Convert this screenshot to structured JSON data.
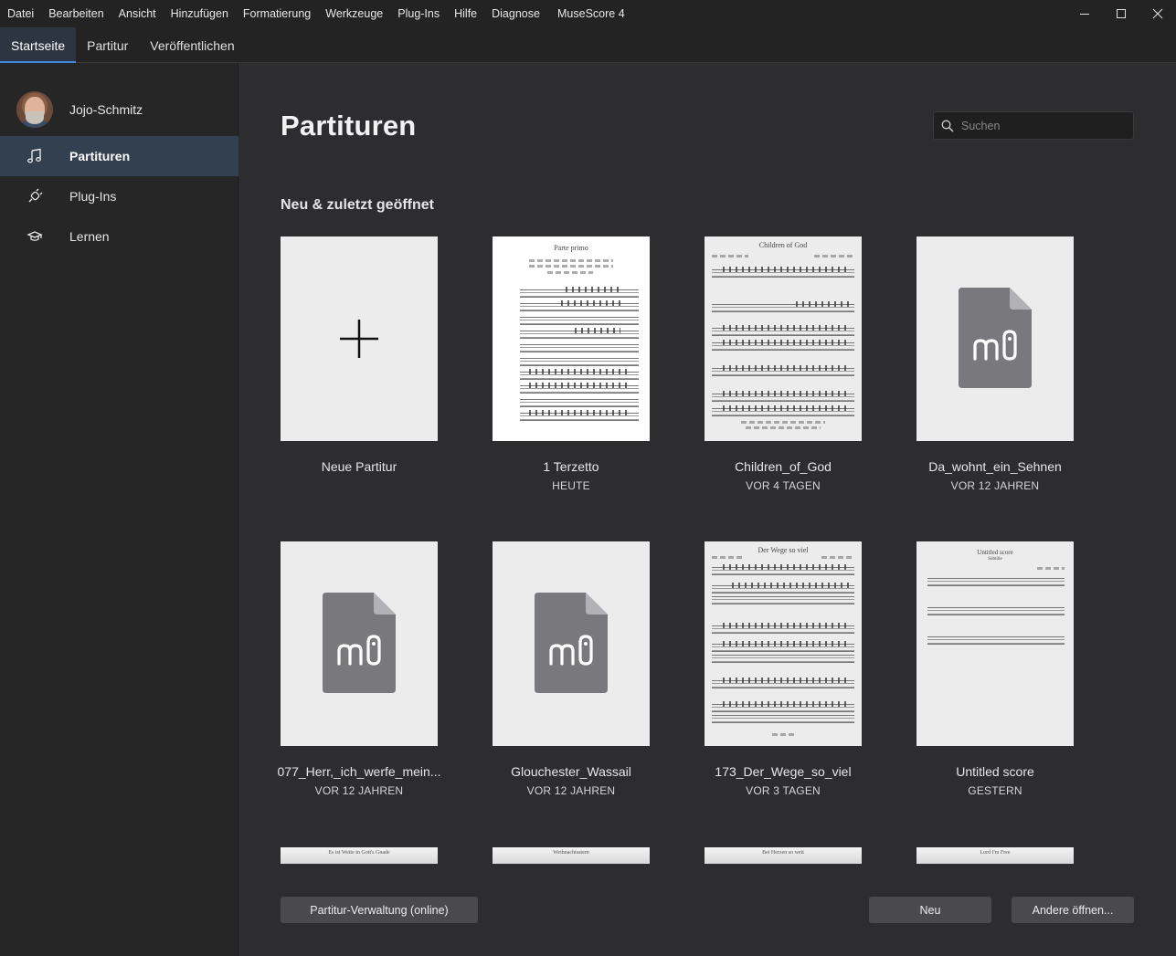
{
  "menu": [
    "Datei",
    "Bearbeiten",
    "Ansicht",
    "Hinzufügen",
    "Formatierung",
    "Werkzeuge",
    "Plug-Ins",
    "Hilfe",
    "Diagnose"
  ],
  "app_title": "MuseScore 4",
  "tabs": [
    "Startseite",
    "Partitur",
    "Veröffentlichen"
  ],
  "sidebar": {
    "user_name": "Jojo-Schmitz",
    "items": [
      {
        "label": "Partituren",
        "icon": "music-note-icon",
        "active": true
      },
      {
        "label": "Plug-Ins",
        "icon": "plug-icon",
        "active": false
      },
      {
        "label": "Lernen",
        "icon": "graduation-cap-icon",
        "active": false
      }
    ]
  },
  "main": {
    "title": "Partituren",
    "search_placeholder": "Suchen",
    "section_title": "Neu & zuletzt geöffnet",
    "scores": [
      {
        "name": "Neue Partitur",
        "date": ""
      },
      {
        "name": "1 Terzetto",
        "date": "HEUTE"
      },
      {
        "name": "Children_of_God",
        "date": "VOR 4 TAGEN"
      },
      {
        "name": "Da_wohnt_ein_Sehnen",
        "date": "VOR 12 JAHREN"
      },
      {
        "name": "077_Herr,_ich_werfe_mein...",
        "date": "VOR 12 JAHREN"
      },
      {
        "name": "Glouchester_Wassail",
        "date": "VOR 12 JAHREN"
      },
      {
        "name": "173_Der_Wege_so_viel",
        "date": "VOR 3 TAGEN"
      },
      {
        "name": "Untitled score",
        "date": "GESTERN"
      }
    ],
    "thumbnail_titles": {
      "terzetto": "Parte primo",
      "children": "Children of God",
      "wege": "Der Wege so viel",
      "untitled": "Untitled score",
      "untitled_sub": "Subtitle"
    },
    "partial_titles": [
      "Es ist Weite in Gott's Gnade",
      "Weihnachtsstern",
      "Bei Herzen so weit",
      "Lord I'm Free"
    ],
    "buttons": {
      "online": "Partitur-Verwaltung (online)",
      "new": "Neu",
      "open_other": "Andere öffnen..."
    }
  },
  "colors": {
    "accent": "#3d8be0",
    "sidebar_active": "#33404f",
    "background": "#2d2d30"
  }
}
